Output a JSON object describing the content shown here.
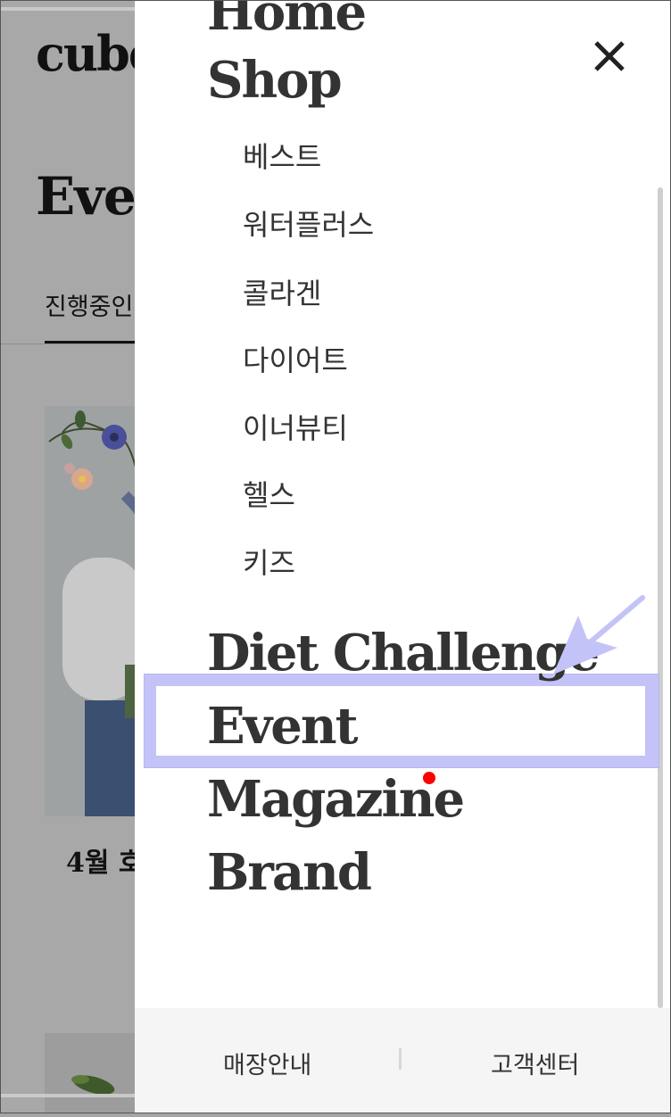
{
  "background": {
    "logo": "cube",
    "page_title": "Even",
    "tab_active": "진행중인",
    "card_caption": "4월 호"
  },
  "drawer": {
    "close_label": "✕",
    "menu": [
      {
        "label": "Home"
      },
      {
        "label": "Shop"
      },
      {
        "label": "Diet Challenge"
      },
      {
        "label": "Event"
      },
      {
        "label": "Magazine"
      },
      {
        "label": "Brand"
      }
    ],
    "shop_sub": [
      "베스트",
      "워터플러스",
      "콜라겐",
      "다이어트",
      "이너뷰티",
      "헬스",
      "키즈"
    ],
    "footer": {
      "store_label": "매장안내",
      "support_label": "고객센터"
    }
  },
  "colors": {
    "highlight": "#c3c3f7",
    "arrow": "#c3c3f7",
    "notification": "#ff0000",
    "menu_text": "#333333"
  }
}
